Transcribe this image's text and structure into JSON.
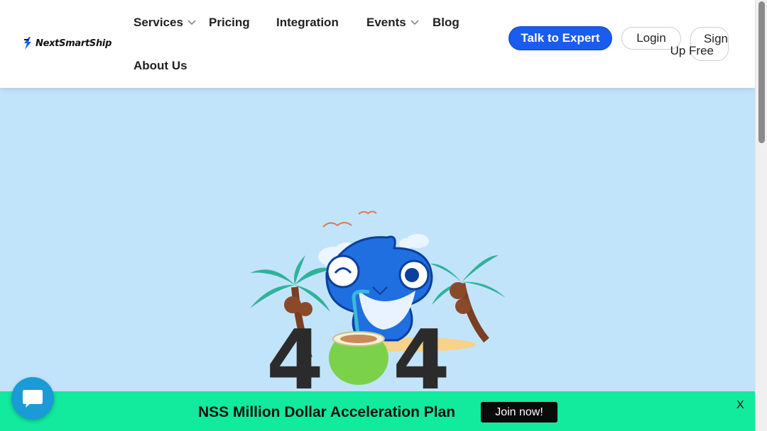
{
  "brand": {
    "name": "NextSmartShip"
  },
  "nav": {
    "items": [
      {
        "label": "Services",
        "has_dropdown": true
      },
      {
        "label": "Pricing",
        "has_dropdown": false
      },
      {
        "label": "Integration",
        "has_dropdown": false
      },
      {
        "label": "Events",
        "has_dropdown": true
      },
      {
        "label": "Blog",
        "has_dropdown": false
      },
      {
        "label": "About Us",
        "has_dropdown": false
      }
    ]
  },
  "actions": {
    "expert_label": "Talk to Expert",
    "login_label": "Login",
    "signup_line1": "Sign",
    "signup_line2": "Up Free"
  },
  "error": {
    "code_left": "4",
    "code_right": "4"
  },
  "promo": {
    "text": "NSS Million Dollar Acceleration Plan",
    "button_label": "Join now!",
    "close_label": "X"
  },
  "colors": {
    "page_bg": "#c2e4fb",
    "primary": "#1a5cf0",
    "promo_bg": "#12ea9e",
    "chat": "#1a9bd6"
  },
  "icons": [
    "logo-bolt-icon",
    "chevron-down-icon",
    "chat-bubble-icon",
    "close-icon"
  ]
}
